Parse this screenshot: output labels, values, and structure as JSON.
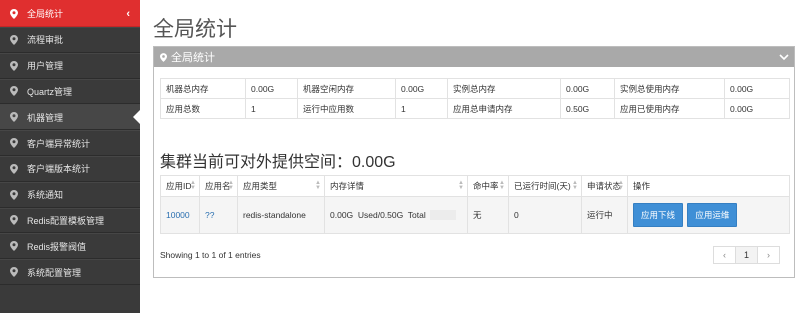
{
  "sidebar": {
    "items": [
      {
        "label": "全局统计"
      },
      {
        "label": "流程审批"
      },
      {
        "label": "用户管理"
      },
      {
        "label": "Quartz管理"
      },
      {
        "label": "机器管理"
      },
      {
        "label": "客户端异常统计"
      },
      {
        "label": "客户端版本统计"
      },
      {
        "label": "系统通知"
      },
      {
        "label": "Redis配置模板管理"
      },
      {
        "label": "Redis报警阀值"
      },
      {
        "label": "系统配置管理"
      }
    ],
    "collapse_glyph": "‹"
  },
  "page": {
    "title": "全局统计"
  },
  "panel": {
    "title": "全局统计"
  },
  "stats": {
    "rows": [
      [
        {
          "label": "机器总内存",
          "value": "0.00G"
        },
        {
          "label": "机器空闲内存",
          "value": "0.00G"
        },
        {
          "label": "实例总内存",
          "value": "0.00G"
        },
        {
          "label": "实例总使用内存",
          "value": "0.00G"
        }
      ],
      [
        {
          "label": "应用总数",
          "value": "1"
        },
        {
          "label": "运行中应用数",
          "value": "1"
        },
        {
          "label": "应用总申请内存",
          "value": "0.50G"
        },
        {
          "label": "应用已使用内存",
          "value": "0.00G"
        }
      ]
    ]
  },
  "capacity": {
    "text": "集群当前可对外提供空间：0.00G"
  },
  "apps": {
    "headers": [
      "应用ID",
      "应用名",
      "应用类型",
      "内存详情",
      "命中率",
      "已运行时间(天)",
      "申请状态",
      "操作"
    ],
    "rows": [
      {
        "id": "10000",
        "name": "??",
        "type": "redis-standalone",
        "memory": "0.00G  Used/0.50G  Total",
        "hit_rate": "无",
        "uptime": "0",
        "status": "运行中",
        "btn_offline": "应用下线",
        "btn_ops": "应用运维"
      }
    ]
  },
  "table_info": {
    "text": "Showing 1 to 1 of 1 entries"
  },
  "pagination": {
    "prev": "‹",
    "current": "1",
    "next": "›"
  },
  "colors": {
    "sidebar_bg": "#3a3a3a",
    "active": "#e02f2f",
    "primary_button": "#3f8fd6",
    "panel_header": "#a9a9a9"
  }
}
